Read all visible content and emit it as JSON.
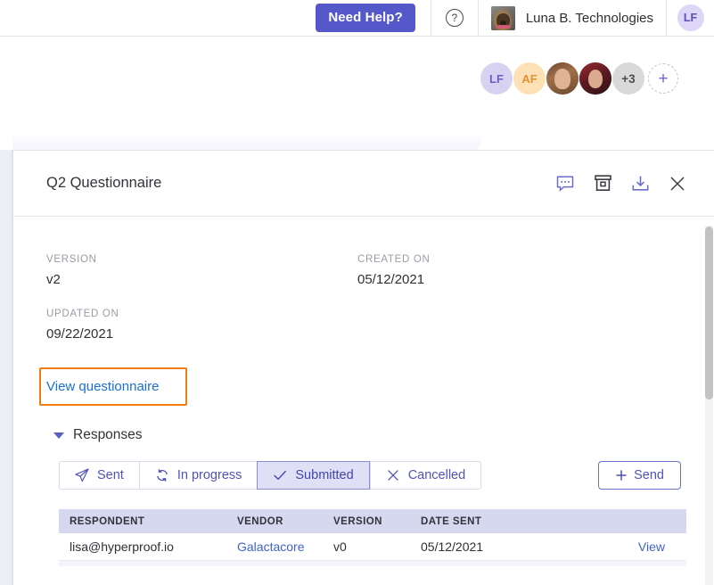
{
  "topbar": {
    "need_help_label": "Need Help?",
    "help_icon": "question-circle-icon",
    "org_name": "Luna B. Technologies",
    "user_initials": "LF"
  },
  "collaborators": {
    "avatars": [
      {
        "type": "initials",
        "label": "LF"
      },
      {
        "type": "initials",
        "label": "AF"
      },
      {
        "type": "photo",
        "label": ""
      },
      {
        "type": "photo",
        "label": ""
      },
      {
        "type": "overflow",
        "label": "+3"
      }
    ],
    "add_label": "+"
  },
  "panel": {
    "title": "Q2 Questionnaire",
    "actions": [
      {
        "name": "comment-icon",
        "label": "Comments"
      },
      {
        "name": "archive-icon",
        "label": "Archive"
      },
      {
        "name": "download-icon",
        "label": "Download"
      },
      {
        "name": "close-icon",
        "label": "Close"
      }
    ],
    "meta": [
      {
        "label": "VERSION",
        "value": "v2"
      },
      {
        "label": "CREATED ON",
        "value": "05/12/2021"
      },
      {
        "label": "UPDATED ON",
        "value": "09/22/2021"
      }
    ],
    "view_questionnaire_label": "View questionnaire",
    "responses_section_label": "Responses",
    "filters": [
      {
        "label": "Sent",
        "icon": "paper-plane-icon",
        "active": false
      },
      {
        "label": "In progress",
        "icon": "refresh-icon",
        "active": false
      },
      {
        "label": "Submitted",
        "icon": "check-icon",
        "active": true
      },
      {
        "label": "Cancelled",
        "icon": "x-icon",
        "active": false
      }
    ],
    "send_button_label": "Send",
    "table": {
      "columns": [
        "RESPONDENT",
        "VENDOR",
        "VERSION",
        "DATE SENT",
        ""
      ],
      "rows": [
        {
          "respondent": "lisa@hyperproof.io",
          "vendor": "Galactacore",
          "version": "v0",
          "date_sent": "05/12/2021",
          "action": "View"
        }
      ]
    }
  },
  "colors": {
    "brand_purple": "#5558c8",
    "link_blue": "#1a6fd4",
    "highlight_orange": "#f07d0f",
    "active_tab_bg": "#dfe0f5",
    "table_header_bg": "#d6d8ef"
  }
}
